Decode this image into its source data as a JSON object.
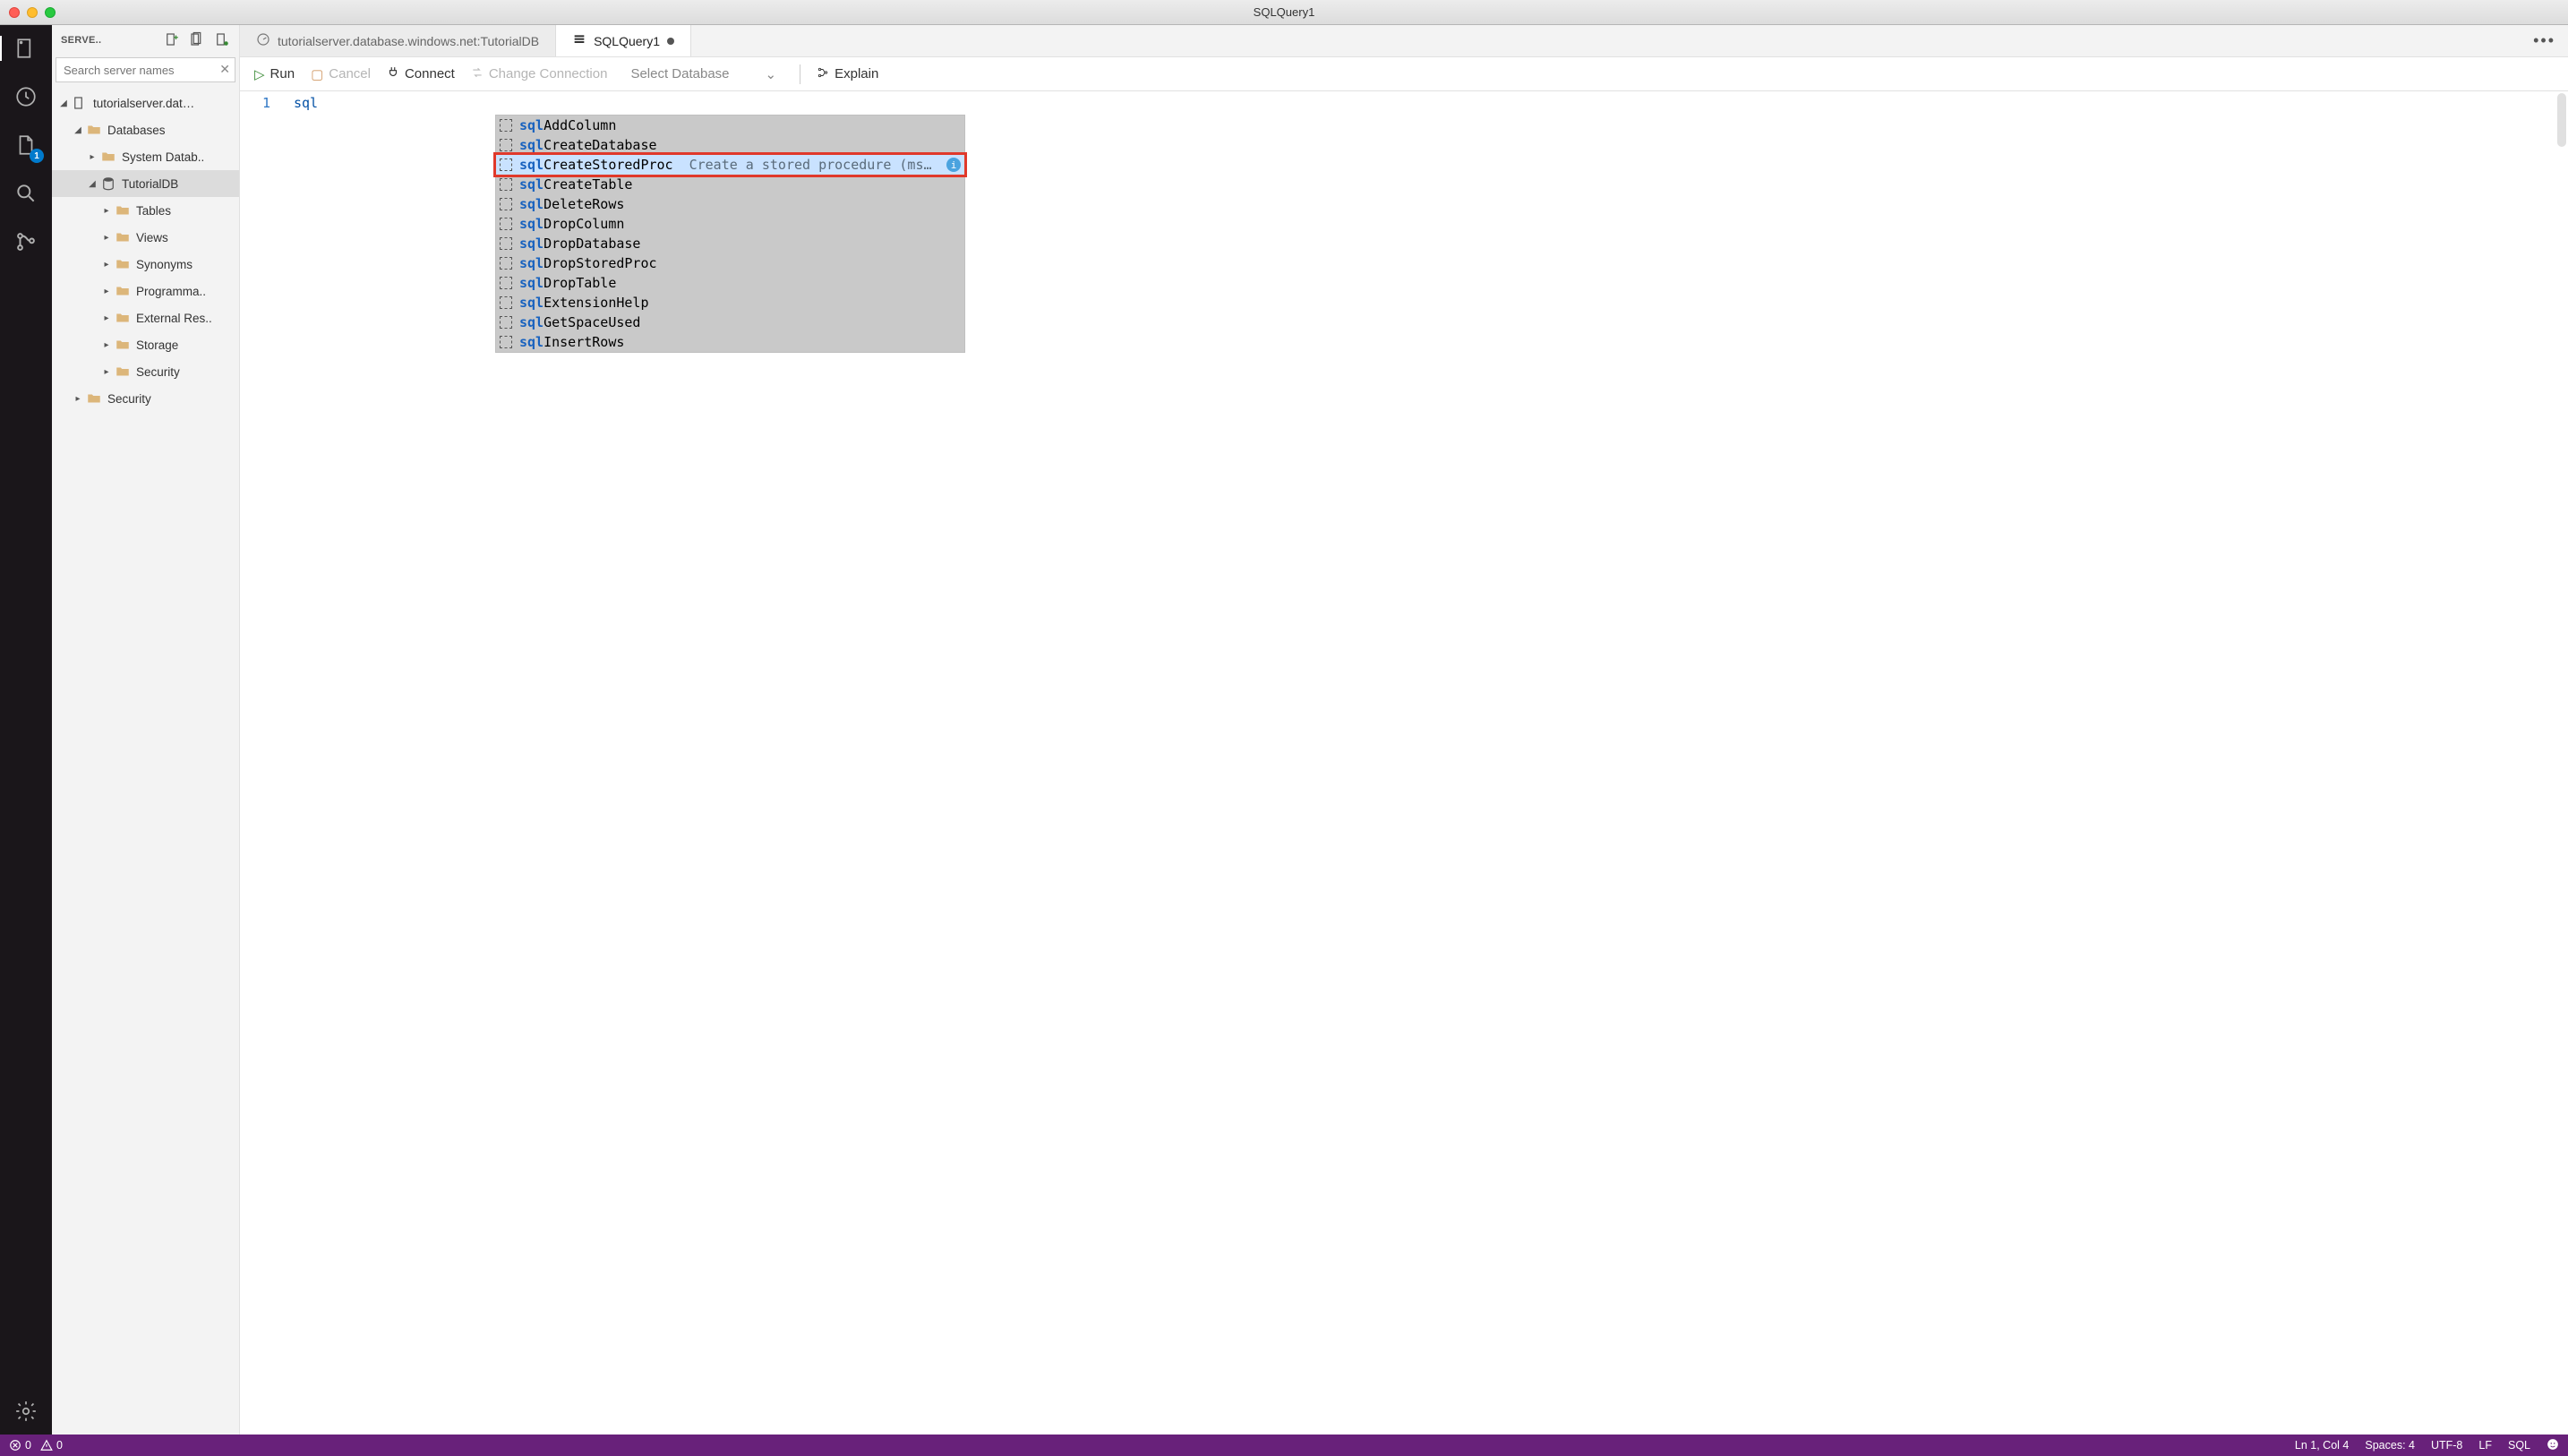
{
  "window": {
    "title": "SQLQuery1"
  },
  "activitybar": {
    "badge_count": "1"
  },
  "sidebar": {
    "header_label": "SERVE..",
    "search_placeholder": "Search server names",
    "server_label": "tutorialserver.dat…",
    "databases_label": "Databases",
    "system_db_label": "System Datab..",
    "tutorialdb_label": "TutorialDB",
    "folders": {
      "tables": "Tables",
      "views": "Views",
      "synonyms": "Synonyms",
      "programmability": "Programma..",
      "external_resources": "External Res..",
      "storage": "Storage",
      "security_inner": "Security"
    },
    "security_label": "Security"
  },
  "tabs": {
    "dashboard": "tutorialserver.database.windows.net:TutorialDB",
    "query": "SQLQuery1"
  },
  "toolbar": {
    "run": "Run",
    "cancel": "Cancel",
    "connect": "Connect",
    "change_connection": "Change Connection",
    "select_db": "Select Database",
    "explain": "Explain"
  },
  "editor": {
    "line_no": "1",
    "typed": "sql",
    "suggestions": [
      {
        "match": "sql",
        "rest": "AddColumn",
        "desc": ""
      },
      {
        "match": "sql",
        "rest": "CreateDatabase",
        "desc": ""
      },
      {
        "match": "sql",
        "rest": "CreateStoredProc",
        "desc": "Create a stored procedure (mssq…",
        "highlight": true,
        "info": true
      },
      {
        "match": "sql",
        "rest": "CreateTable",
        "desc": ""
      },
      {
        "match": "sql",
        "rest": "DeleteRows",
        "desc": ""
      },
      {
        "match": "sql",
        "rest": "DropColumn",
        "desc": ""
      },
      {
        "match": "sql",
        "rest": "DropDatabase",
        "desc": ""
      },
      {
        "match": "sql",
        "rest": "DropStoredProc",
        "desc": ""
      },
      {
        "match": "sql",
        "rest": "DropTable",
        "desc": ""
      },
      {
        "match": "sql",
        "rest": "ExtensionHelp",
        "desc": ""
      },
      {
        "match": "sql",
        "rest": "GetSpaceUsed",
        "desc": ""
      },
      {
        "match": "sql",
        "rest": "InsertRows",
        "desc": ""
      }
    ]
  },
  "statusbar": {
    "errors": "0",
    "warnings": "0",
    "ln_col": "Ln 1, Col 4",
    "spaces": "Spaces: 4",
    "encoding": "UTF-8",
    "eol": "LF",
    "lang": "SQL"
  }
}
